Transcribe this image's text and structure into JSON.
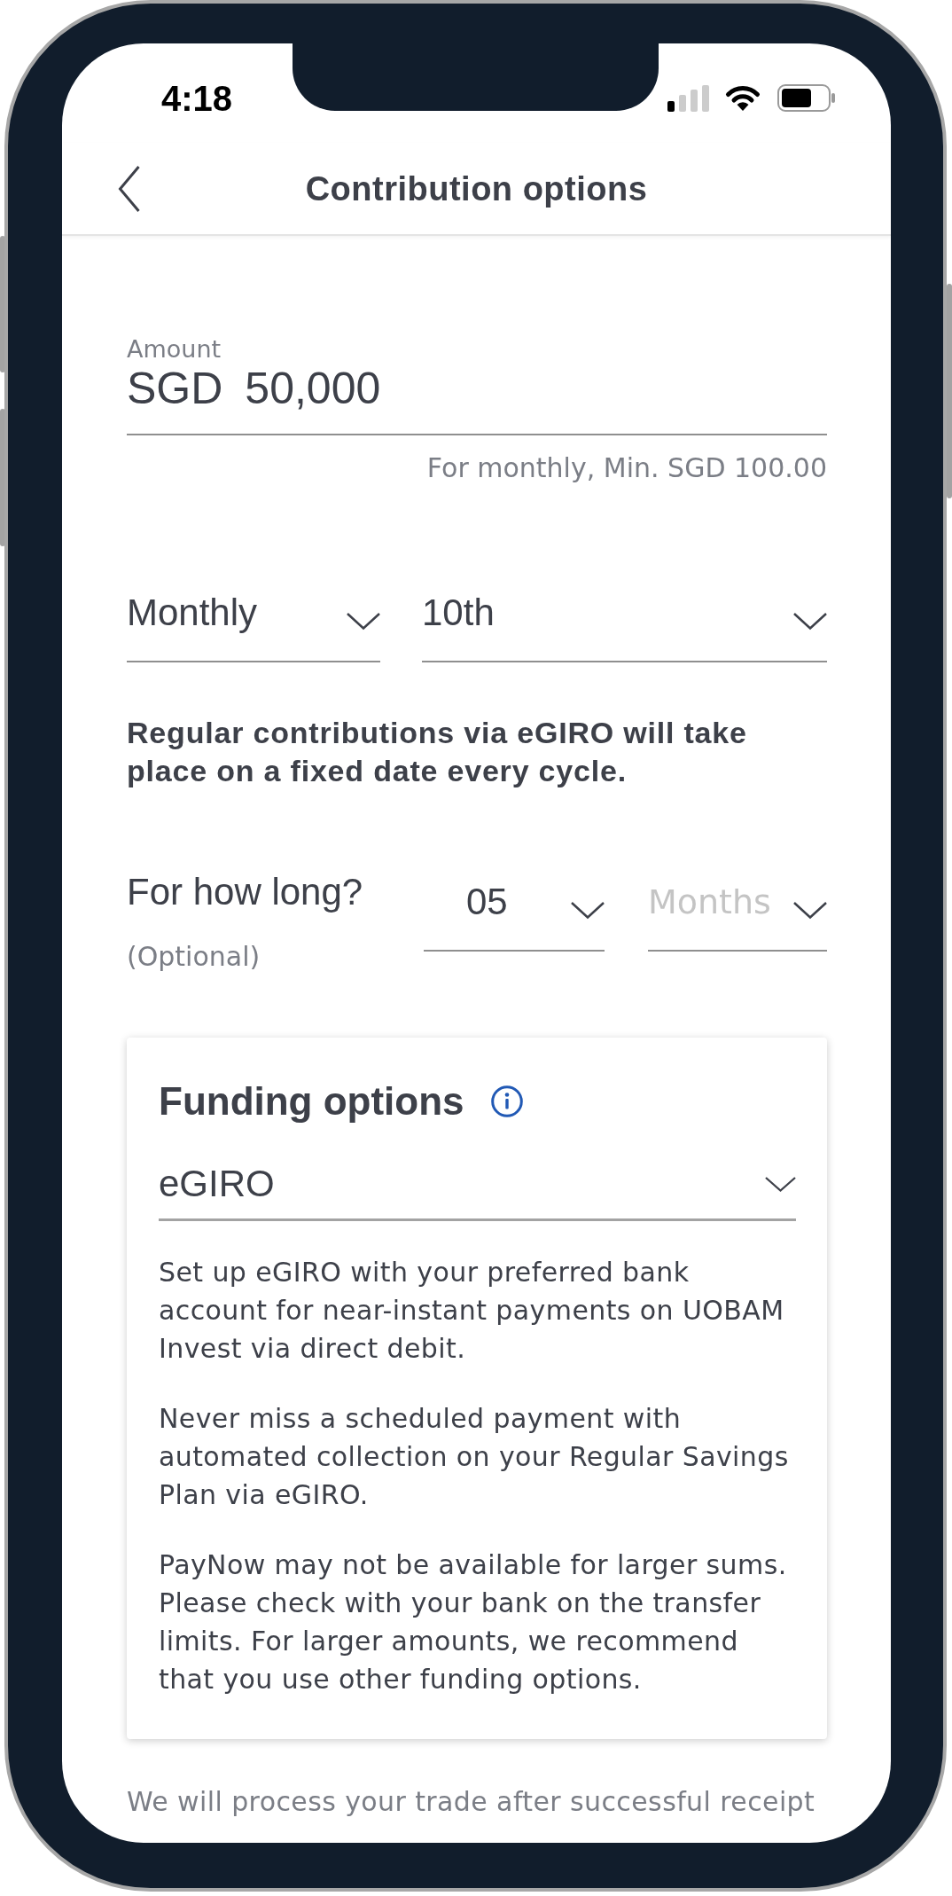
{
  "status_bar": {
    "time": "4:18"
  },
  "header": {
    "title": "Contribution options"
  },
  "amount": {
    "label": "Amount",
    "currency": "SGD",
    "value": "50,000",
    "hint": "For monthly, Min. SGD 100.00"
  },
  "schedule": {
    "frequency": {
      "value": "Monthly"
    },
    "day": {
      "value": "10th"
    },
    "note": "Regular contributions via eGIRO will take place on a fixed date every cycle."
  },
  "duration": {
    "label": "For how long?",
    "sublabel": "(Optional)",
    "count": {
      "value": "05"
    },
    "unit": {
      "placeholder": "Months"
    }
  },
  "funding": {
    "title": "Funding options",
    "method": {
      "value": "eGIRO"
    },
    "paragraphs": [
      "Set up eGIRO with your preferred bank account for near-instant payments on UOBAM Invest via direct debit.",
      "Never miss a scheduled payment with automated collection on your Regular Savings Plan via eGIRO.",
      "PayNow may not be available for larger sums. Please check with your bank on the transfer limits. For larger amounts, we recommend that you use other funding options."
    ]
  },
  "footer_note": "We will process your trade after successful receipt"
}
